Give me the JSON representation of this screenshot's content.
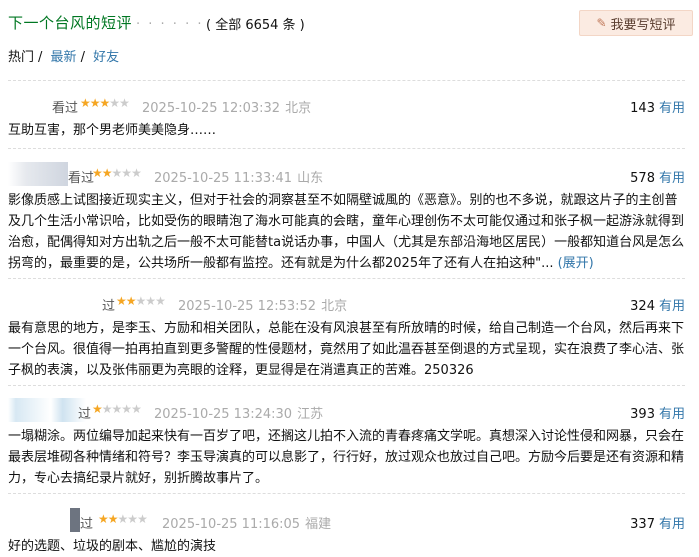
{
  "header": {
    "title": "下一个台风的短评",
    "dots": "· · · · · ·",
    "count": "( 全部 6654 条 )",
    "write_label": "我要写短评"
  },
  "filters": {
    "hot": "热门",
    "latest": "最新",
    "friends": "好友"
  },
  "useful_label": "有用",
  "reviews": [
    {
      "name": "看过",
      "stars": 3,
      "time": "2025-10-25 12:03:32",
      "location": "北京",
      "votes": "143",
      "content": "互助互害，那个男老师美美隐身……"
    },
    {
      "name": "看过",
      "stars": 2,
      "time": "2025-10-25 11:33:41",
      "location": "山东",
      "votes": "578",
      "content": "影像质感上试图接近现实主义，但对于社会的洞察甚至不如隔壁诚風的《恶意》。别的也不多说，就跟这片子的主创普及几个生活小常识哈，比如受伤的眼睛泡了海水可能真的会瞎，童年心理创伤不太可能仅通过和张子枫一起游泳就得到治愈，配偶得知对方出轨之后一般不太可能替ta说话办事，中国人（尤其是东部沿海地区居民）一般都知道台风是怎么拐弯的，最重要的是，公共场所一般都有监控。还有就是为什么都2025年了还有人在拍这种\"...",
      "expand": "(展开)"
    },
    {
      "name": "过",
      "stars": 2,
      "time": "2025-10-25 12:53:52",
      "location": "北京",
      "votes": "324",
      "content": "最有意思的地方，是李玉、方励和相关团队，总能在没有风浪甚至有所放晴的时候，给自己制造一个台风，然后再来下一个台风。很值得一拍再拍直到更多警醒的性侵题材，竟然用了如此温吞甚至倒退的方式呈现，实在浪费了李心洁、张子枫的表演，以及张伟丽更为亮眼的诠释，更显得是在消遣真正的苦难。250326"
    },
    {
      "name": "过",
      "stars": 1,
      "time": "2025-10-25 13:24:30",
      "location": "江苏",
      "votes": "393",
      "content": "一塌糊涂。两位编导加起来快有一百岁了吧，还搁这儿拍不入流的青春疼痛文学呢。真想深入讨论性侵和网暴，只会在最表层堆砌各种情绪和符号？李玉导演真的可以息影了，行行好，放过观众也放过自己吧。方励今后要是还有资源和精力，专心去搞纪录片就好，别折腾故事片了。"
    },
    {
      "name": "过",
      "stars": 2,
      "time": "2025-10-25 11:16:05",
      "location": "福建",
      "votes": "337",
      "content": "好的选题、垃圾的剧本、尴尬的演技"
    }
  ]
}
